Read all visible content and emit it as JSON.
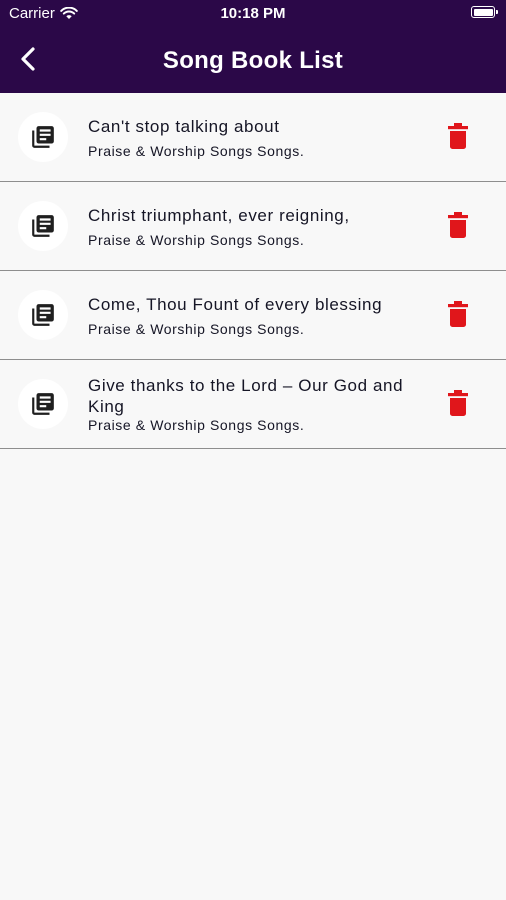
{
  "status_bar": {
    "carrier": "Carrier",
    "time": "10:18 PM"
  },
  "navbar": {
    "title": "Song Book List"
  },
  "songs": [
    {
      "title": "Can't stop talking about",
      "subtitle": "Praise & Worship Songs Songs."
    },
    {
      "title": "Christ triumphant, ever reigning,",
      "subtitle": "Praise & Worship Songs Songs."
    },
    {
      "title": "Come, Thou Fount of every blessing",
      "subtitle": "Praise & Worship Songs Songs."
    },
    {
      "title": "Give thanks to the Lord – Our God and King",
      "subtitle": "Praise & Worship Songs Songs."
    }
  ],
  "icons": {
    "row": "library-books-icon",
    "delete": "trash-icon",
    "back": "chevron-left-icon"
  },
  "colors": {
    "navbar": "#2b0848",
    "delete": "#e0161b",
    "background": "#f8f8f8"
  }
}
